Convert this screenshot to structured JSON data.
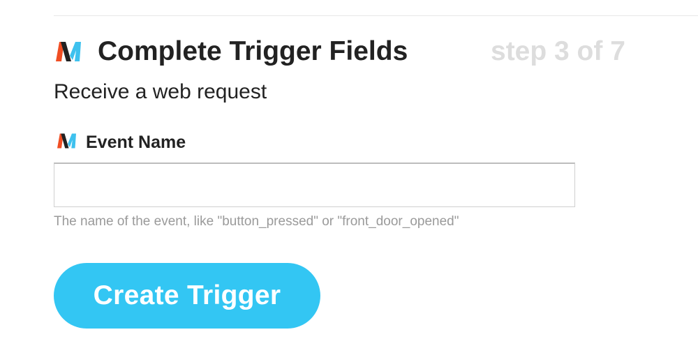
{
  "header": {
    "title": "Complete Trigger Fields",
    "step": "step 3 of 7",
    "logo_icon": "maker-logo-icon"
  },
  "subtitle": "Receive a web request",
  "field": {
    "label": "Event Name",
    "icon": "maker-logo-icon",
    "value": "",
    "placeholder": "",
    "help": "The name of the event, like \"button_pressed\" or \"front_door_opened\""
  },
  "actions": {
    "create_label": "Create Trigger"
  },
  "colors": {
    "accent": "#33c6f3",
    "logo_orange": "#f04e23",
    "logo_blue": "#3ec1ee",
    "logo_dark": "#222222",
    "step_text": "#dddddd",
    "help_text": "#9a9a9a"
  }
}
